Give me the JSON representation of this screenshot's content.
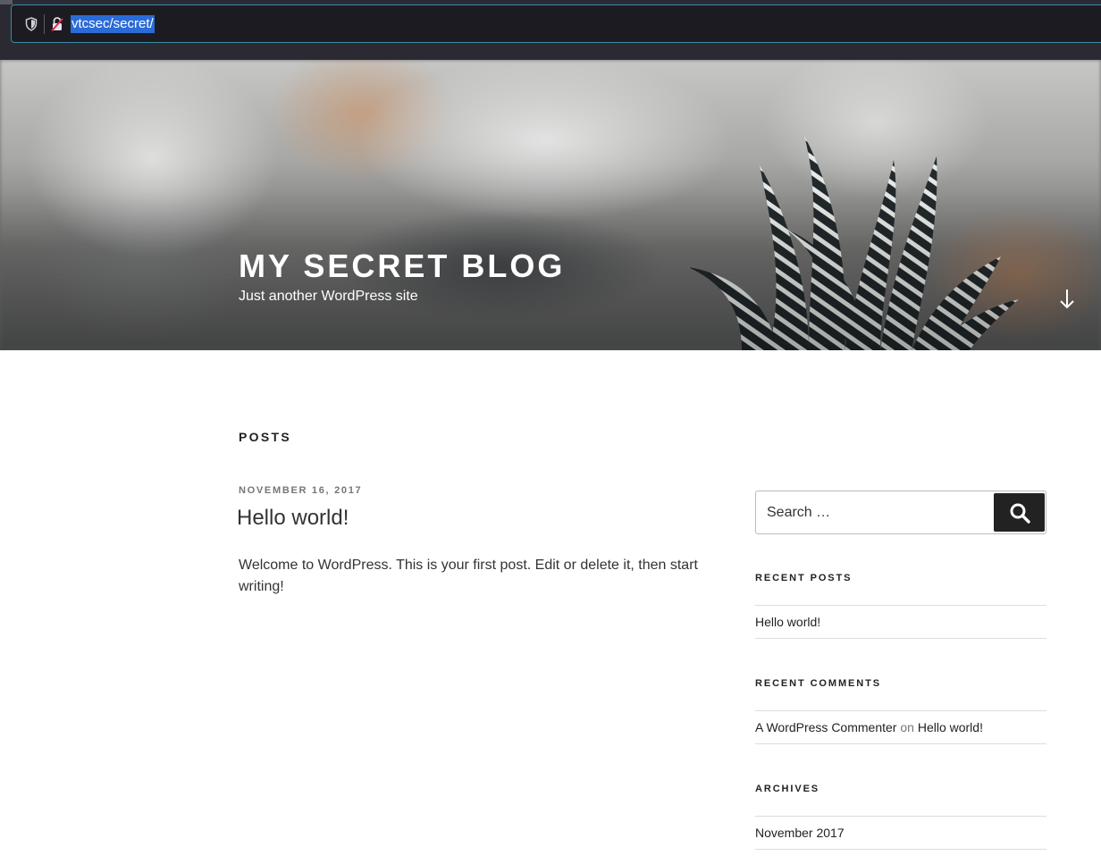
{
  "browser": {
    "url": "vtcsec/secret/"
  },
  "site": {
    "title": "MY SECRET BLOG",
    "description": "Just another WordPress site"
  },
  "main": {
    "section_title": "POSTS",
    "posts": [
      {
        "date": "NOVEMBER 16, 2017",
        "title": "Hello world!",
        "excerpt": "Welcome to WordPress. This is your first post. Edit or delete it, then start writing!"
      }
    ]
  },
  "sidebar": {
    "search": {
      "placeholder": "Search …",
      "button_label": "Search"
    },
    "recent_posts": {
      "title": "RECENT POSTS",
      "items": [
        {
          "label": "Hello world!"
        }
      ]
    },
    "recent_comments": {
      "title": "RECENT COMMENTS",
      "items": [
        {
          "author": "A WordPress Commenter",
          "connector": "on",
          "post": "Hello world!"
        }
      ]
    },
    "archives": {
      "title": "ARCHIVES",
      "items": [
        {
          "label": "November 2017"
        }
      ]
    }
  },
  "icons": {
    "tracking_protection": "shield-icon",
    "connection_insecure": "lock-slash-icon",
    "scroll_down": "arrow-down-icon",
    "search": "search-icon"
  },
  "colors": {
    "browser_toolbar": "#2b2a33",
    "url_field": "#1c1b22",
    "url_selection": "#2a6bd8",
    "search_button": "#222222",
    "meta_text": "#767676"
  }
}
